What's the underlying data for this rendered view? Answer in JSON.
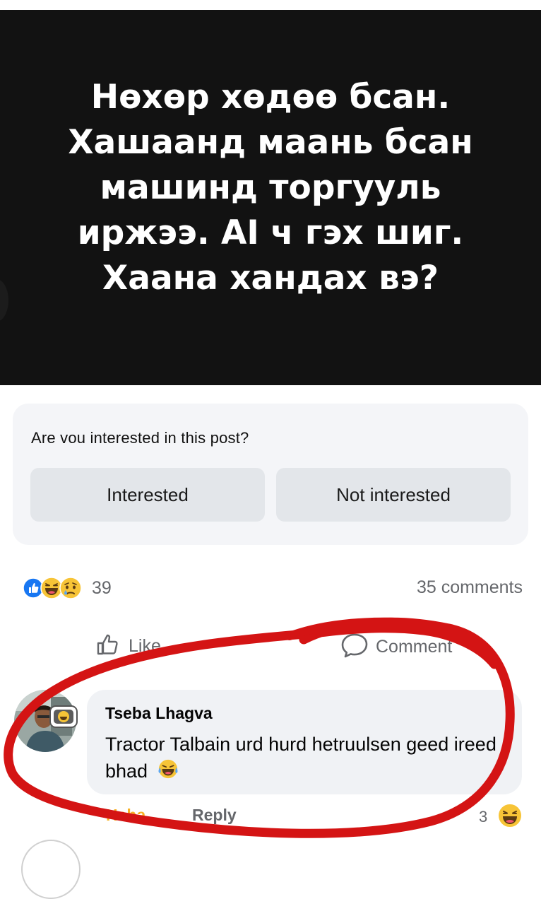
{
  "post": {
    "text": "Нөхөр хөдөө бсан.\nХашаанд маань бсан\nмашинд торгууль\nиржээ. AI ч гэх шиг.\nХаана хандах вэ?"
  },
  "interest_prompt": {
    "question": "Are vou interested in this post?",
    "interested_label": "Interested",
    "not_interested_label": "Not interested"
  },
  "stats": {
    "reaction_count": "39",
    "reaction_icons": [
      "like-icon",
      "haha-icon",
      "sad-icon"
    ],
    "comments": "35 comments"
  },
  "actions": {
    "like_label": "Like",
    "comment_label": "Comment"
  },
  "comment": {
    "author": "Tseba Lhagva",
    "text": "Tractor Talbain urd hurd hetruulsen geed ireed bhad",
    "emoji": "laughing-tears-icon",
    "reaction_label": "Haha",
    "reply_label": "Reply",
    "reaction_count": "3"
  },
  "colors": {
    "image_bg": "#121212",
    "facebook_blue": "#1877f2",
    "haha_yellow": "#f7b125",
    "annotation_red": "#d41414"
  }
}
